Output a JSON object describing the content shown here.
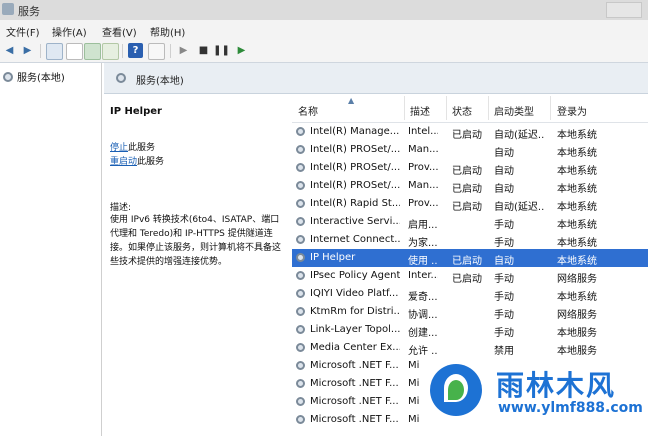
{
  "window": {
    "title": "服务"
  },
  "menu": [
    "文件(F)",
    "操作(A)",
    "查看(V)",
    "帮助(H)"
  ],
  "left_panel": {
    "node": "服务(本地)"
  },
  "right_header": {
    "title": "服务(本地)"
  },
  "description": {
    "service_name": "IP Helper",
    "stop_link": "停止",
    "stop_suffix": "此服务",
    "restart_link": "重启动",
    "restart_suffix": "此服务",
    "desc_label": "描述:",
    "desc_text": "使用 IPv6 转换技术(6to4、ISATAP、端口代理和 Teredo)和 IP-HTTPS 提供隧道连接。如果停止该服务，则计算机将不具备这些技术提供的增强连接优势。"
  },
  "columns": [
    "名称",
    "描述",
    "状态",
    "启动类型",
    "登录为"
  ],
  "rows": [
    {
      "name": "Intel(R) Manage...",
      "desc": "Intel...",
      "status": "已启动",
      "startup": "自动(延迟...",
      "logon": "本地系统"
    },
    {
      "name": "Intel(R) PROSet/...",
      "desc": "Man...",
      "status": "",
      "startup": "自动",
      "logon": "本地系统"
    },
    {
      "name": "Intel(R) PROSet/...",
      "desc": "Prov...",
      "status": "已启动",
      "startup": "自动",
      "logon": "本地系统"
    },
    {
      "name": "Intel(R) PROSet/...",
      "desc": "Man...",
      "status": "已启动",
      "startup": "自动",
      "logon": "本地系统"
    },
    {
      "name": "Intel(R) Rapid St...",
      "desc": "Prov...",
      "status": "已启动",
      "startup": "自动(延迟...",
      "logon": "本地系统"
    },
    {
      "name": "Interactive Servi...",
      "desc": "启用...",
      "status": "",
      "startup": "手动",
      "logon": "本地系统"
    },
    {
      "name": "Internet Connect...",
      "desc": "为家...",
      "status": "",
      "startup": "手动",
      "logon": "本地系统"
    },
    {
      "name": "IP Helper",
      "desc": "使用 ...",
      "status": "已启动",
      "startup": "自动",
      "logon": "本地系统",
      "selected": true
    },
    {
      "name": "IPsec Policy Agent",
      "desc": "Inter...",
      "status": "已启动",
      "startup": "手动",
      "logon": "网络服务"
    },
    {
      "name": "IQIYI Video Platf...",
      "desc": "爱奇...",
      "status": "",
      "startup": "手动",
      "logon": "本地系统"
    },
    {
      "name": "KtmRm for Distri...",
      "desc": "协调...",
      "status": "",
      "startup": "手动",
      "logon": "网络服务"
    },
    {
      "name": "Link-Layer Topol...",
      "desc": "创建...",
      "status": "",
      "startup": "手动",
      "logon": "本地服务"
    },
    {
      "name": "Media Center Ex...",
      "desc": "允许 ...",
      "status": "",
      "startup": "禁用",
      "logon": "本地服务"
    },
    {
      "name": "Microsoft .NET F...",
      "desc": "Mi",
      "status": "",
      "startup": "",
      "logon": ""
    },
    {
      "name": "Microsoft .NET F...",
      "desc": "Mi",
      "status": "",
      "startup": "",
      "logon": ""
    },
    {
      "name": "Microsoft .NET F...",
      "desc": "Mi",
      "status": "",
      "startup": "",
      "logon": ""
    },
    {
      "name": "Microsoft .NET F...",
      "desc": "Mi",
      "status": "",
      "startup": "",
      "logon": ""
    }
  ],
  "watermark": {
    "brand": "雨林木风",
    "url": "www.ylmf888.com"
  },
  "colors": {
    "selected_row": "#2f6fd1",
    "link": "#1a5fb4",
    "brand": "#1d72d4"
  }
}
